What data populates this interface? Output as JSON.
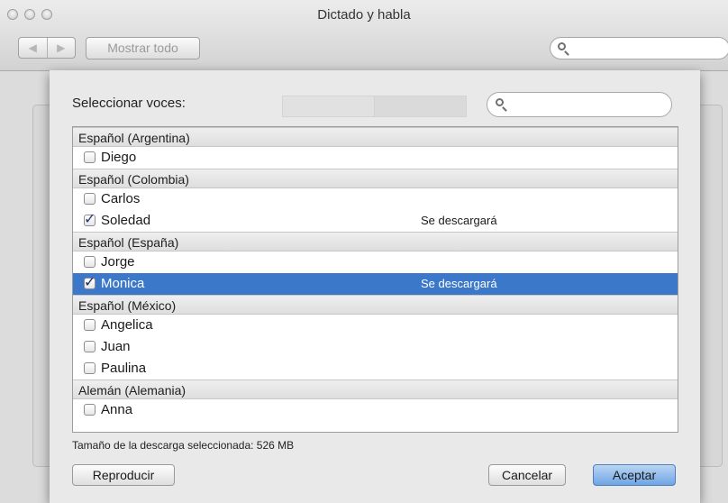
{
  "window": {
    "title": "Dictado y habla"
  },
  "toolbar": {
    "back_glyph": "◀",
    "forward_glyph": "▶",
    "show_all_label": "Mostrar todo"
  },
  "sheet": {
    "select_label": "Seleccionar voces:",
    "groups": [
      {
        "header": "Español (Argentina)",
        "voices": [
          {
            "name": "Diego",
            "checked": false,
            "status": ""
          }
        ]
      },
      {
        "header": "Español (Colombia)",
        "voices": [
          {
            "name": "Carlos",
            "checked": false,
            "status": ""
          },
          {
            "name": "Soledad",
            "checked": true,
            "status": "Se descargará"
          }
        ]
      },
      {
        "header": "Español (España)",
        "voices": [
          {
            "name": "Jorge",
            "checked": false,
            "status": ""
          },
          {
            "name": "Monica",
            "checked": true,
            "status": "Se descargará",
            "selected": true
          }
        ]
      },
      {
        "header": "Español (México)",
        "voices": [
          {
            "name": "Angelica",
            "checked": false,
            "status": ""
          },
          {
            "name": "Juan",
            "checked": false,
            "status": ""
          },
          {
            "name": "Paulina",
            "checked": false,
            "status": ""
          }
        ]
      },
      {
        "header": "Alemán (Alemania)",
        "voices": [
          {
            "name": "Anna",
            "checked": false,
            "status": ""
          }
        ]
      }
    ],
    "download_size": "Tamaño de la descarga seleccionada: 526 MB",
    "play_label": "Reproducir",
    "cancel_label": "Cancelar",
    "ok_label": "Aceptar"
  },
  "colors": {
    "selection": "#3b78c9",
    "default_button": "#6fa5e4"
  }
}
